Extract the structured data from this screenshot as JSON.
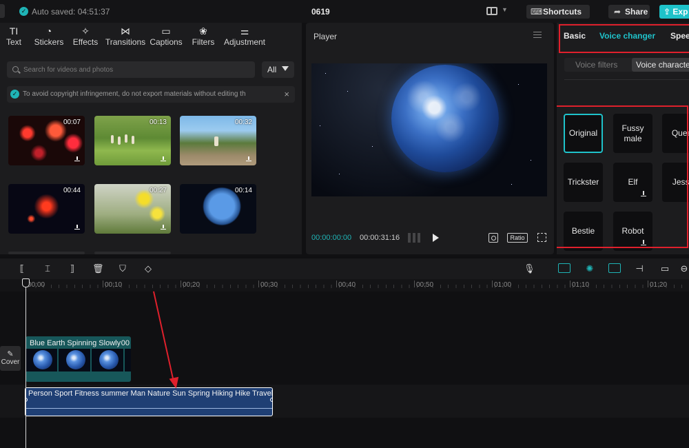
{
  "topbar": {
    "autosave": "Auto saved: 04:51:37",
    "project_name": "0619",
    "shortcuts_label": "Shortcuts",
    "share_label": "Share",
    "export_label": "Exp"
  },
  "media_tabs": [
    {
      "label": "Text",
      "icon": "text-icon"
    },
    {
      "label": "Stickers",
      "icon": "sticker-icon"
    },
    {
      "label": "Effects",
      "icon": "effects-icon"
    },
    {
      "label": "Transitions",
      "icon": "transitions-icon"
    },
    {
      "label": "Captions",
      "icon": "captions-icon"
    },
    {
      "label": "Filters",
      "icon": "filters-icon"
    },
    {
      "label": "Adjustment",
      "icon": "adjustment-icon"
    }
  ],
  "media": {
    "search_placeholder": "Search for videos and photos",
    "filter_label": "All",
    "notice": "To avoid copyright infringement, do not export materials without editing th",
    "thumbnails": [
      {
        "duration": "00:07"
      },
      {
        "duration": "00:13"
      },
      {
        "duration": "00:32"
      },
      {
        "duration": "00:44"
      },
      {
        "duration": "00:27"
      },
      {
        "duration": "00:14"
      }
    ]
  },
  "player": {
    "title": "Player",
    "current_time": "00:00:00:00",
    "total_time": "00:00:31:16",
    "ratio_label": "Ratio"
  },
  "right_panel": {
    "tabs": [
      {
        "label": "Basic",
        "active": false
      },
      {
        "label": "Voice changer",
        "active": true
      },
      {
        "label": "Spee",
        "active": false
      }
    ],
    "sub_tabs": [
      "Voice filters",
      "Voice characte"
    ],
    "voices": [
      {
        "label": "Original",
        "selected": true,
        "download": false
      },
      {
        "label": "Fussy male",
        "selected": false,
        "download": false
      },
      {
        "label": "Quee",
        "selected": false,
        "download": false
      },
      {
        "label": "Trickster",
        "selected": false,
        "download": false
      },
      {
        "label": "Elf",
        "selected": false,
        "download": true
      },
      {
        "label": "Jessi",
        "selected": false,
        "download": false
      },
      {
        "label": "Bestie",
        "selected": false,
        "download": false
      },
      {
        "label": "Robot",
        "selected": false,
        "download": true
      }
    ]
  },
  "timeline": {
    "ticks": [
      "00:00",
      "00:10",
      "00:20",
      "00:30",
      "00:40",
      "00:50",
      "01:00",
      "01:10",
      "01:20"
    ],
    "cover_label": "Cover",
    "video_clip": {
      "title": "Blue Earth Spinning Slowly",
      "duration": "00"
    },
    "audio_clip": {
      "title": "Person Sport Fitness summer Man Nature Sun Spring Hiking Hike Travel N"
    }
  },
  "colors": {
    "accent": "#1fc3cb",
    "highlight": "#e0202c",
    "background": "#101012",
    "panel": "#1c1c1e"
  }
}
